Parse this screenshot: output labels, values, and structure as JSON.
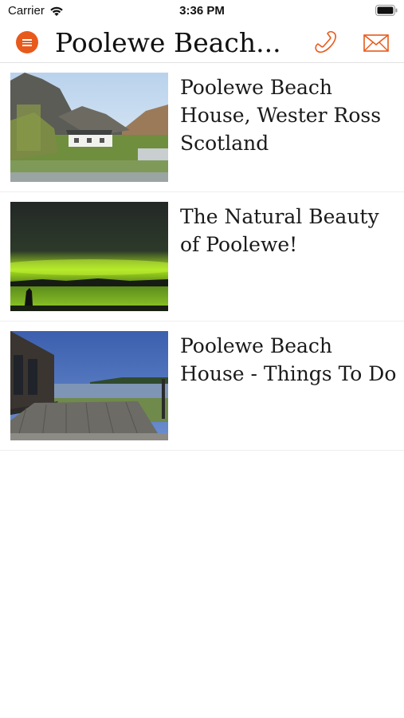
{
  "status_bar": {
    "carrier": "Carrier",
    "time": "3:36 PM"
  },
  "header": {
    "title": "Poolewe Beach...",
    "menu_icon": "menu-icon",
    "phone_icon": "phone-icon",
    "mail_icon": "mail-icon",
    "accent_color": "#e85a1b"
  },
  "articles": [
    {
      "title": "Poolewe Beach House, Wester Ross Scotland",
      "image": "cottage-landscape-photo"
    },
    {
      "title": "The Natural Beauty of Poolewe!",
      "image": "aurora-night-photo"
    },
    {
      "title": "Poolewe Beach House - Things To Do",
      "image": "deck-lake-photo"
    }
  ]
}
